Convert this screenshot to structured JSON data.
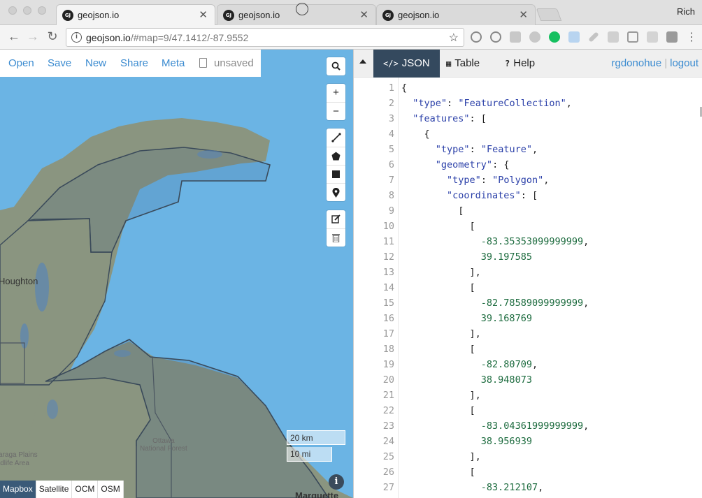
{
  "browser": {
    "tabs": [
      {
        "title": "geojson.io",
        "favicon": "GJ"
      },
      {
        "title": "geojson.io",
        "favicon": "GJ"
      },
      {
        "title": "geojson.io",
        "favicon": "GJ"
      }
    ],
    "profile_name": "Rich",
    "url_host": "geojson.io",
    "url_rest": "/#map=9/47.1412/-87.9552"
  },
  "map": {
    "nav": {
      "open": "Open",
      "save": "Save",
      "new": "New",
      "share": "Share",
      "meta": "Meta",
      "status": "unsaved"
    },
    "labels": {
      "houghton": "Houghton",
      "ottawa": "Ottawa\nNational Forest",
      "plains": "araga Plains\nldlife Area",
      "marquette": "Marquette"
    },
    "scale_km": "20 km",
    "scale_mi": "10 mi",
    "layers": [
      "Mapbox",
      "Satellite",
      "OCM",
      "OSM"
    ],
    "active_layer": "Mapbox",
    "info_glyph": "i",
    "colors": {
      "water": "#6bb4e4",
      "land": "#8a9580",
      "polygon": "#3e5f86"
    }
  },
  "panel": {
    "tabs": [
      {
        "label": "JSON",
        "icon": "</>"
      },
      {
        "label": "Table",
        "icon": "table-icon"
      },
      {
        "label": "Help",
        "icon": "?"
      }
    ],
    "active_tab": "JSON",
    "user": "rgdonohue",
    "logout": "logout"
  },
  "editor": {
    "lines": [
      {
        "n": "1",
        "text": "{"
      },
      {
        "n": "2",
        "text": "  \"type\": \"FeatureCollection\","
      },
      {
        "n": "3",
        "text": "  \"features\": ["
      },
      {
        "n": "4",
        "text": "    {"
      },
      {
        "n": "5",
        "text": "      \"type\": \"Feature\","
      },
      {
        "n": "6",
        "text": "      \"geometry\": {"
      },
      {
        "n": "7",
        "text": "        \"type\": \"Polygon\","
      },
      {
        "n": "8",
        "text": "        \"coordinates\": ["
      },
      {
        "n": "9",
        "text": "          ["
      },
      {
        "n": "10",
        "text": "            ["
      },
      {
        "n": "11",
        "text": "              -83.35353099999999,"
      },
      {
        "n": "12",
        "text": "              39.197585"
      },
      {
        "n": "13",
        "text": "            ],"
      },
      {
        "n": "14",
        "text": "            ["
      },
      {
        "n": "15",
        "text": "              -82.78589099999999,"
      },
      {
        "n": "16",
        "text": "              39.168769"
      },
      {
        "n": "17",
        "text": "            ],"
      },
      {
        "n": "18",
        "text": "            ["
      },
      {
        "n": "19",
        "text": "              -82.80709,"
      },
      {
        "n": "20",
        "text": "              38.948073"
      },
      {
        "n": "21",
        "text": "            ],"
      },
      {
        "n": "22",
        "text": "            ["
      },
      {
        "n": "23",
        "text": "              -83.04361999999999,"
      },
      {
        "n": "24",
        "text": "              38.956939"
      },
      {
        "n": "25",
        "text": "            ],"
      },
      {
        "n": "26",
        "text": "            ["
      },
      {
        "n": "27",
        "text": "              -83.212107,"
      }
    ]
  }
}
